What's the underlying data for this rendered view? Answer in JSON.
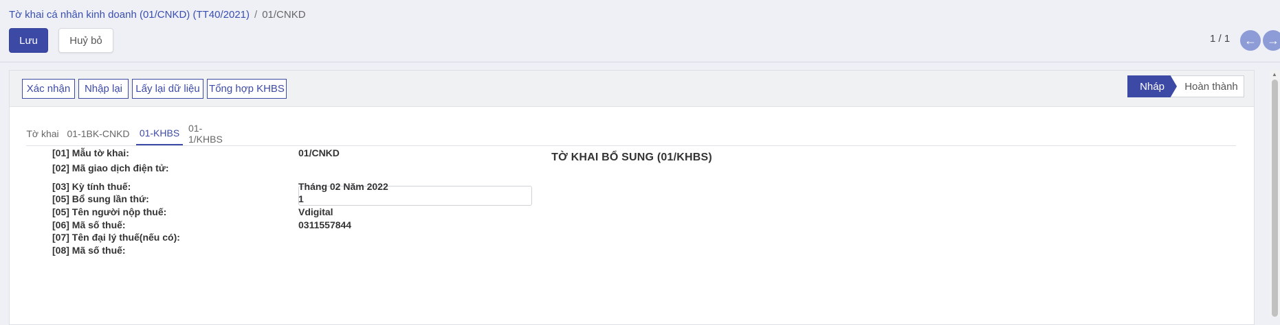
{
  "breadcrumb": {
    "parent": "Tờ khai cá nhân kinh doanh (01/CNKD) (TT40/2021)",
    "separator": "/",
    "current": "01/CNKD"
  },
  "toolbar": {
    "save_label": "Lưu",
    "discard_label": "Huỷ bỏ"
  },
  "pager": {
    "value": "1 / 1",
    "prev_icon": "arrow-left-icon",
    "next_icon": "arrow-right-icon"
  },
  "actions": {
    "confirm": "Xác nhận",
    "reenter": "Nhập lại",
    "reload": "Lấy lại dữ liệu",
    "summary": "Tổng hợp KHBS"
  },
  "statusbar": {
    "draft": "Nháp",
    "done": "Hoàn thành"
  },
  "tabs": [
    {
      "label": "Tờ khai"
    },
    {
      "label": "01-1BK-CNKD"
    },
    {
      "label": "01-KHBS"
    },
    {
      "label": "01-1/KHBS"
    }
  ],
  "form": {
    "title": "TỜ KHAI BỔ SUNG (01/KHBS)",
    "rows": [
      {
        "label": "[01] Mẫu tờ khai:",
        "value": "01/CNKD"
      },
      {
        "label": "[02] Mã giao dịch điện tử:",
        "value": ""
      },
      {
        "label": "[03] Kỳ tính thuế:",
        "value": "Tháng 02 Năm 2022"
      },
      {
        "label": "[05] Bổ sung lần thứ:",
        "value": "1"
      },
      {
        "label": "[05] Tên người nộp thuế:",
        "value": "Vdigital"
      },
      {
        "label": "[06] Mã số thuế:",
        "value": "0311557844"
      },
      {
        "label": "[07] Tên đại lý thuế(nếu có):",
        "value": ""
      },
      {
        "label": "[08] Mã số thuế:",
        "value": ""
      }
    ]
  },
  "colors": {
    "primary": "#3c4aa6",
    "nav_button": "#8d9bd6"
  }
}
